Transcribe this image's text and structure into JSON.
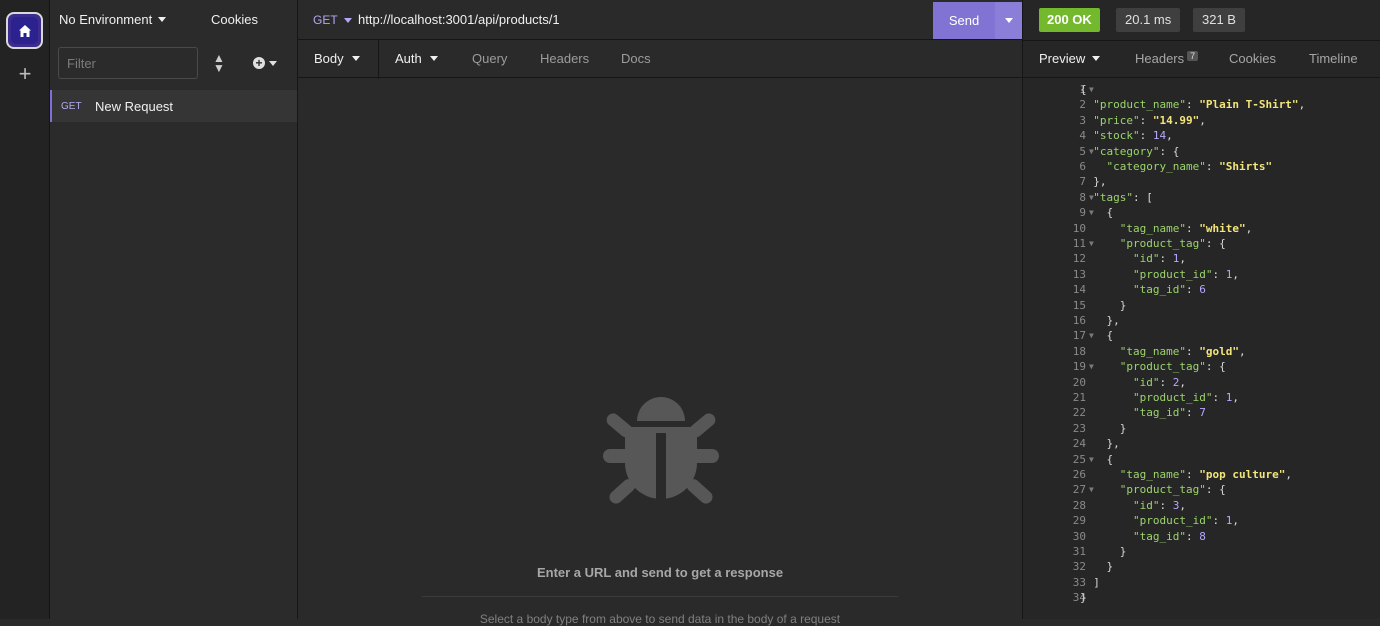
{
  "sidebar": {
    "environment": "No Environment",
    "cookies": "Cookies",
    "filter_placeholder": "Filter",
    "request": {
      "method": "GET",
      "name": "New Request"
    }
  },
  "urlbar": {
    "method": "GET",
    "url": "http://localhost:3001/api/products/1",
    "send": "Send"
  },
  "request_tabs": [
    "Body",
    "Auth",
    "Query",
    "Headers",
    "Docs"
  ],
  "empty_state": {
    "message": "Enter a URL and send to get a response",
    "sub": "Select a body type from above to send data in the body of a request"
  },
  "response": {
    "status": "200 OK",
    "time": "20.1 ms",
    "size": "321 B",
    "tabs": [
      "Preview",
      "Headers",
      "Cookies",
      "Timeline"
    ],
    "headers_count": "7"
  },
  "colors": {
    "accent": "#8073d3",
    "status_ok": "#73b82d",
    "json_key": "#9bd46b",
    "json_string": "#f2e57a",
    "json_number": "#b8a8ff"
  },
  "code_lines": [
    "{",
    "  \"product_name\": \"Plain T-Shirt\",",
    "  \"price\": \"14.99\",",
    "  \"stock\": 14,",
    "  \"category\": {",
    "    \"category_name\": \"Shirts\"",
    "  },",
    "  \"tags\": [",
    "    {",
    "      \"tag_name\": \"white\",",
    "      \"product_tag\": {",
    "        \"id\": 1,",
    "        \"product_id\": 1,",
    "        \"tag_id\": 6",
    "      }",
    "    },",
    "    {",
    "      \"tag_name\": \"gold\",",
    "      \"product_tag\": {",
    "        \"id\": 2,",
    "        \"product_id\": 1,",
    "        \"tag_id\": 7",
    "      }",
    "    },",
    "    {",
    "      \"tag_name\": \"pop culture\",",
    "      \"product_tag\": {",
    "        \"id\": 3,",
    "        \"product_id\": 1,",
    "        \"tag_id\": 8",
    "      }",
    "    }",
    "  ]",
    "}"
  ]
}
